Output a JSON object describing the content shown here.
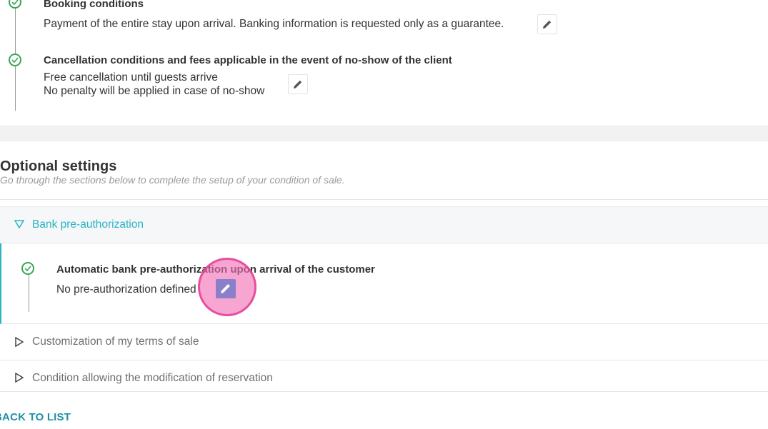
{
  "required": {
    "booking": {
      "title": "Booking conditions",
      "description": "Payment of the entire stay upon arrival. Banking information is requested only as a guarantee."
    },
    "cancellation": {
      "title": "Cancellation conditions and fees applicable in the event of no-show of the client",
      "line1": "Free cancellation until guests arrive",
      "line2": "No penalty will be applied in case of no-show"
    }
  },
  "optional": {
    "title": "Optional settings",
    "subtitle": "Go through the sections below to complete the setup of your condition of sale.",
    "sections": [
      {
        "label": "Bank pre-authorization",
        "expanded": true,
        "item": {
          "title": "Automatic bank pre-authorization upon arrival of the customer",
          "value": "No pre-authorization defined"
        }
      },
      {
        "label": "Customization of my terms of sale",
        "expanded": false
      },
      {
        "label": "Condition allowing the modification of reservation",
        "expanded": false
      }
    ]
  },
  "footer": {
    "back_label": "BACK TO LIST"
  },
  "colors": {
    "accent": "#29b3c3",
    "check": "#3aa655",
    "link": "#1f8fa8",
    "cursor": "#f26eb4",
    "edit_active": "#8a80c9"
  },
  "icons": [
    "check-circle-icon",
    "pencil-icon",
    "triangle-down-icon",
    "triangle-right-icon"
  ]
}
